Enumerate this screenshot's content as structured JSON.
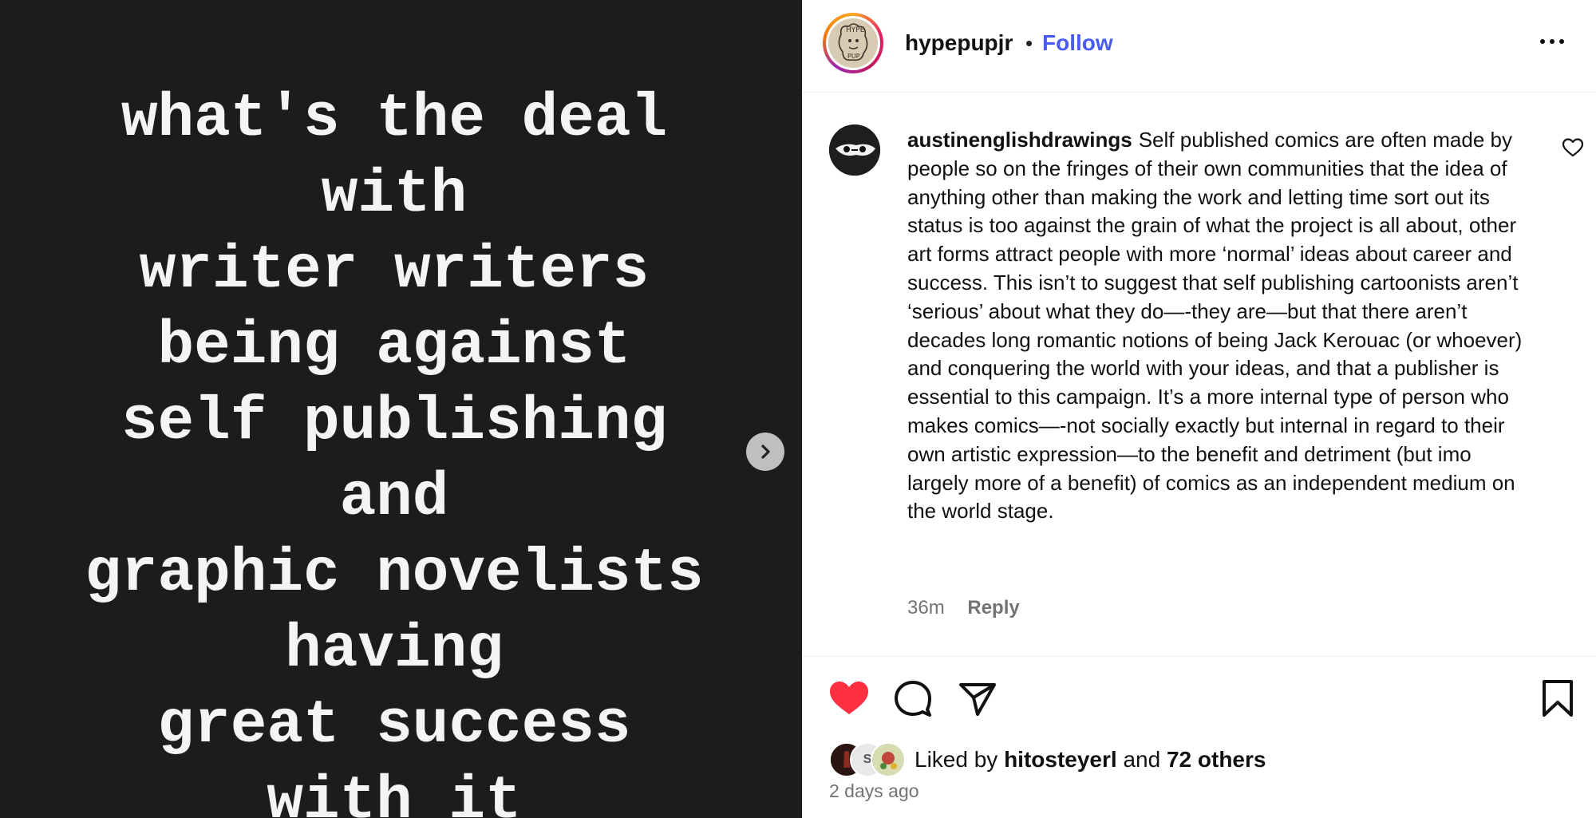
{
  "media": {
    "lines": [
      "what's the deal",
      "with",
      "writer writers",
      "being against",
      "self publishing",
      "and",
      "graphic novelists",
      "having",
      "great success",
      "with it"
    ],
    "next_icon": "chevron-right-icon"
  },
  "header": {
    "avatar_text": "HYPE PUP JR",
    "username": "hypepupjr",
    "separator": "•",
    "follow_label": "Follow",
    "more_icon": "more-horizontal-icon"
  },
  "comment": {
    "username": "austinenglishdrawings",
    "text": "Self published comics are often made by people so on the fringes of their own communities that the idea of anything other than making the work and letting time sort out its status is too against the grain of what the project is all about, other art forms attract people with more ‘normal’ ideas about career and success. This isn’t to suggest that self publishing cartoonists aren’t ‘serious’ about what they do—-they are—but that there aren’t decades long romantic notions of being Jack Kerouac (or whoever) and conquering the world with your ideas, and that a publisher is essential to this campaign. It’s a more internal type of person who makes comics—-not socially exactly but internal in regard to their own artistic expression—to the benefit and detriment (but imo largely more of a benefit) of comics as an independent medium on the world stage.",
    "time": "36m",
    "reply_label": "Reply",
    "like_icon": "heart-outline-icon"
  },
  "actions": {
    "like_icon": "heart-filled-icon",
    "comment_icon": "comment-icon",
    "share_icon": "send-icon",
    "save_icon": "bookmark-icon",
    "liked": true
  },
  "likes": {
    "prefix": "Liked by",
    "first_user": "hitosteyerl",
    "connector": "and",
    "others": "72 others",
    "liker_2_initial": "S"
  },
  "post_date": "2 days ago",
  "colors": {
    "accent": "#4a5bf0",
    "like_red": "#ff3040",
    "media_bg": "#1c1c1c",
    "muted": "#737373"
  }
}
